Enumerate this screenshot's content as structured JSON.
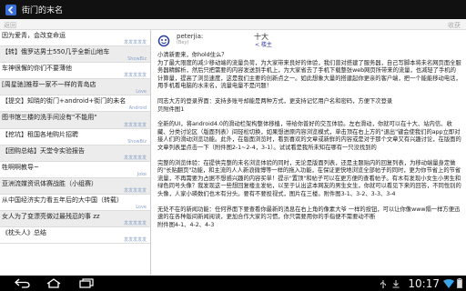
{
  "app_bar": {
    "title": "街门的末名"
  },
  "sub_bar": {
    "left": "返回",
    "right": "收获"
  },
  "topics": [
    {
      "title": "因为爱青，会改变命运",
      "board": "发发发发发"
    },
    {
      "title": "【转】俄罗达男士550几乎全新山地车",
      "board": "ShowBiz"
    },
    {
      "title": "车神很懈的你们不要薄他",
      "board": "发发发发发"
    },
    {
      "title": "[周星驰]推荐一家不一样的青岛店",
      "board": "Love"
    },
    {
      "title": "【提交】知晓的街门+android+街门的未名",
      "board": "Android"
    },
    {
      "title": "图书馆三楼的洗手间没有\"不能用\"",
      "board": "发发发发发"
    },
    {
      "title": "【挖坑】租国各地购片招聘",
      "board": "ShowBiz"
    },
    {
      "title": "【团购总结】天堂令实验报告",
      "board": "发发发发发"
    },
    {
      "title": "牲啊啊教导~",
      "board": "Joke"
    },
    {
      "title": "亚洲流媒资讯体赛战胜（小组赛）",
      "board": "发发发发发"
    },
    {
      "title": "从中国经济实力看五年后的大中国（转载）",
      "board": "Love"
    },
    {
      "title": "女人为了变漂亮做过最残忍的事 zz",
      "board": "发发发发发"
    },
    {
      "title": "《枕头人》总结",
      "board": "发发发发发"
    }
  ],
  "post": {
    "author": "peterjia:",
    "role": "(Bey)",
    "floor": "十大",
    "back_link": "< 楼主",
    "paragraphs": [
      "小清新要来，你hold住么？\n为了最大限度的减少移动端的流量负荷，为大家带来良好的体验，我们曾对搭建了服务器，自己写脚本将未名网页面全服务器精解析，然后只把需要的内容发送到手机上，为大家省去了手机下载整张web网页所带来的流量，也减轻了手机的计算量，提高了浏览速度，这是我们主要的创新点之一。如此想象大量的搭建起你更亲的客户端，把一个能能移动电话，用手机看电脑的水未名，流量电量不是问题！",
      "同志大方的登录界面：支持多账号却能是两种方式，更支持记忆用户名和密码，方便下次登录\n贝附件图1",
      "全新的UI，将android4.0的滑动栏架构整体移植，带给你普好的交互体验。左右滑动，你就可以在十大、站内信、收藏、分类讨论区（版面列表）间轻松切换，如果想进原内容浏览模式，单击顶在右上方的\"退出\"键会使我们的app立即对接人们的滑动浏览功能。此外，在版面浏览时，看到喜欢的文章或新鲜的内容或是对于那个文章又有兴趣讨论，在版面的文章列表里点击一下（附件图2-1~2-4，3-1）。试试看是我所未知在哪有一只没找到的",
      "完整的浏览体验：在提供完整的未名浏览体验的同时，无论是版面列表，还是主题贴内的回复列表，为移动端量身定做的\"长贴翻页\"功能，和主流的人人新浪微博等一样的拖入功能，在保证更快地浏览全部帖子的同时，更为你节省上的节省流量，不再需要为占据不想感兴趣的内容买单！提示\"置顶\"和帖子可以在更方便的查看帖子。有木有发现小女生小男生和绿色同号头像？我发现这一些想回复楼主发帖，以至于认出这本网友的男生女生，你就可以看见下来的回答，不同性别的头像，人家小瑛数们也木有分头。要有不要投视式，图片在三楼。附件图3-1、3-2、3-3、3-4",
      "无处不在的新闻功能：任何界面下要查看你最新的消息在右上角的像素大爷 一样的按钮，可以让你像www隔一样方便迅速的在各种版间新闻阅读，更加合作大家的习惯，你只需要用你的手指便不需要动不断\n附件图4-1、4-2、4-3"
    ]
  },
  "nav": {
    "back": "back",
    "home": "home",
    "recent": "recent-apps"
  },
  "status": {
    "time": "10:17"
  },
  "colors": {
    "app_bar": "#111111",
    "accent": "#3a3aaa",
    "board_label": "#8aa2c8",
    "nav_bar": "#000000"
  }
}
